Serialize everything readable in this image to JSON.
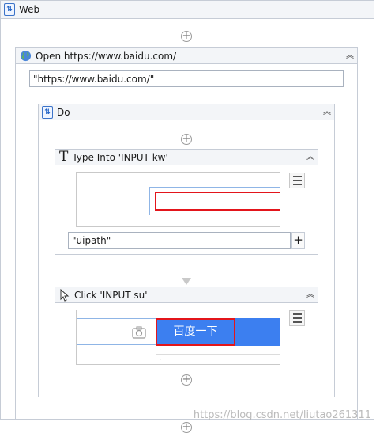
{
  "web": {
    "title": "Web"
  },
  "open": {
    "title": "Open https://www.baidu.com/",
    "url_value": "\"https://www.baidu.com/\""
  },
  "do": {
    "title": "Do"
  },
  "type_into": {
    "title": "Type Into 'INPUT  kw'",
    "text_value": "\"uipath\"",
    "plus_label": "+"
  },
  "click": {
    "title": "Click 'INPUT  su'",
    "button_text": "百度一下",
    "dot_text": "·"
  },
  "add_symbol": "+",
  "watermark": "https://blog.csdn.net/liutao261311",
  "colors": {
    "baidu_blue": "#3c7ff0",
    "highlight_red": "#e3151b",
    "header_bg": "#f3f5f8"
  }
}
